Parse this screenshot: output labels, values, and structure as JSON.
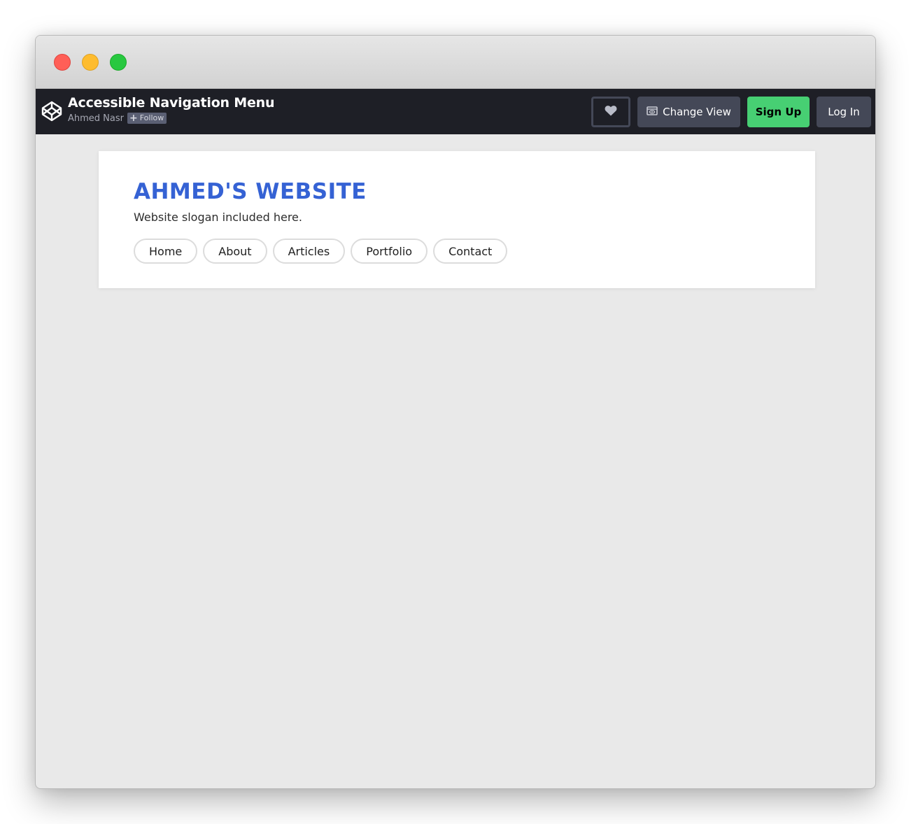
{
  "window": {
    "controls": [
      "close",
      "minimize",
      "maximize"
    ]
  },
  "codepen_header": {
    "logo_icon": "codepen-logo-icon",
    "pen_title": "Accessible Navigation Menu",
    "author": "Ahmed Nasr",
    "follow_label": "Follow",
    "heart_icon": "heart-icon",
    "change_view_label": "Change View",
    "change_view_icon": "eye-window-icon",
    "signup_label": "Sign Up",
    "login_label": "Log In",
    "colors": {
      "header_bg": "#1e1f26",
      "button_bg": "#444857",
      "signup_bg": "#47cf73"
    }
  },
  "site": {
    "title": "AHMED'S WEBSITE",
    "slogan": "Website slogan included here.",
    "title_color": "#3562d4",
    "nav": [
      {
        "label": "Home"
      },
      {
        "label": "About"
      },
      {
        "label": "Articles"
      },
      {
        "label": "Portfolio"
      },
      {
        "label": "Contact"
      }
    ]
  }
}
